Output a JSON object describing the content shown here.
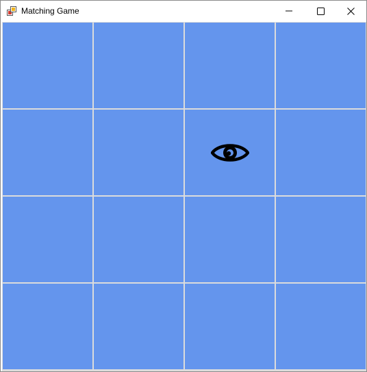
{
  "window": {
    "title": "Matching Game",
    "controls": [
      "minimize",
      "maximize",
      "close"
    ]
  },
  "colors": {
    "tile": "#6495ed",
    "grid_line": "#dcdcdc",
    "icon": "#000000"
  },
  "board": {
    "rows": 4,
    "columns": 4,
    "tiles": [
      {
        "row": 1,
        "col": 1,
        "revealed": false,
        "icon": ""
      },
      {
        "row": 1,
        "col": 2,
        "revealed": false,
        "icon": ""
      },
      {
        "row": 1,
        "col": 3,
        "revealed": false,
        "icon": ""
      },
      {
        "row": 1,
        "col": 4,
        "revealed": false,
        "icon": ""
      },
      {
        "row": 2,
        "col": 1,
        "revealed": false,
        "icon": ""
      },
      {
        "row": 2,
        "col": 2,
        "revealed": false,
        "icon": ""
      },
      {
        "row": 2,
        "col": 3,
        "revealed": true,
        "icon": "eye-icon"
      },
      {
        "row": 2,
        "col": 4,
        "revealed": false,
        "icon": ""
      },
      {
        "row": 3,
        "col": 1,
        "revealed": false,
        "icon": ""
      },
      {
        "row": 3,
        "col": 2,
        "revealed": false,
        "icon": ""
      },
      {
        "row": 3,
        "col": 3,
        "revealed": false,
        "icon": ""
      },
      {
        "row": 3,
        "col": 4,
        "revealed": false,
        "icon": ""
      },
      {
        "row": 4,
        "col": 1,
        "revealed": false,
        "icon": ""
      },
      {
        "row": 4,
        "col": 2,
        "revealed": false,
        "icon": ""
      },
      {
        "row": 4,
        "col": 3,
        "revealed": false,
        "icon": ""
      },
      {
        "row": 4,
        "col": 4,
        "revealed": false,
        "icon": ""
      }
    ]
  }
}
